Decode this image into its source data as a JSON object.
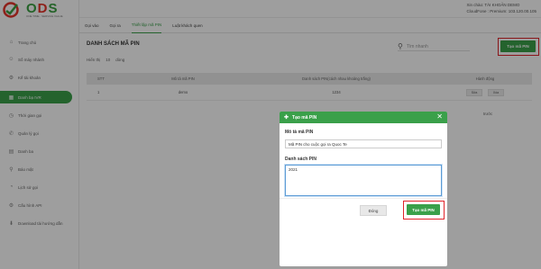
{
  "brand": {
    "name_left": "O",
    "name_mid": "D",
    "name_right": "S",
    "tagline": "ONE TIME · SERVICE VALUE"
  },
  "account": {
    "line1": "Xin chào: TÀI KHOẢN DEMO",
    "line2": "CloudFone : Premium: 103.120.00.105"
  },
  "sidebar": {
    "items": [
      {
        "label": "Trang chủ",
        "icon": "home-icon",
        "glyph": "⌂"
      },
      {
        "label": "Số máy nhánh",
        "icon": "user-icon",
        "glyph": "☺"
      },
      {
        "label": "Kế tài khoản",
        "icon": "gear-icon",
        "glyph": "⚙"
      },
      {
        "label": "Danh bạ IVR",
        "icon": "grid-icon",
        "glyph": "▦"
      },
      {
        "label": "Thời gian gọi",
        "icon": "clock-icon",
        "glyph": "◷"
      },
      {
        "label": "Quản lý gọi",
        "icon": "phone-icon",
        "glyph": "✆"
      },
      {
        "label": "Danh ba",
        "icon": "book-icon",
        "glyph": "▤"
      },
      {
        "label": "Báo mật",
        "icon": "lock-icon",
        "glyph": "⚲"
      },
      {
        "label": "Lịch sử gọi",
        "icon": "history-icon",
        "glyph": "◔"
      },
      {
        "label": "Cấu hình API",
        "icon": "api-icon",
        "glyph": "⚙"
      },
      {
        "label": "Download tài hướng dẫn",
        "icon": "download-icon",
        "glyph": "⬇"
      }
    ]
  },
  "tabs": [
    {
      "label": "Gọi vào"
    },
    {
      "label": "Gọi ra"
    },
    {
      "label": "Thiết lập mã PIN"
    },
    {
      "label": "Luật khách quen"
    }
  ],
  "page": {
    "title": "DANH SÁCH MÃ PIN",
    "show_prefix": "Hiển thị",
    "show_value": "10",
    "show_suffix": "dòng",
    "search_placeholder": "Tìm nhanh",
    "create_button": "Tạo mã PIN"
  },
  "table": {
    "headers": [
      "STT",
      "Mô tả mã PIN",
      "Danh sách PIN(cách nhau khoảng trắng)",
      "Hành động"
    ],
    "rows": [
      {
        "stt": "1",
        "desc": "demo",
        "pins": "1234",
        "edit": "Sửa",
        "delete": "Xóa"
      }
    ],
    "pager": "trước"
  },
  "modal": {
    "title": "Tạo mã PIN",
    "desc_label": "Mô tả mã PIN",
    "desc_value": "Mã PIN cho cuộc gọi ra Quoc Te",
    "list_label": "Danh sách PIN",
    "list_value": "2021",
    "close_button": "Đóng",
    "submit_button": "Tạo mã PIN"
  },
  "colors": {
    "brand_green": "#3aa04a",
    "highlight_red": "#e0242b"
  }
}
